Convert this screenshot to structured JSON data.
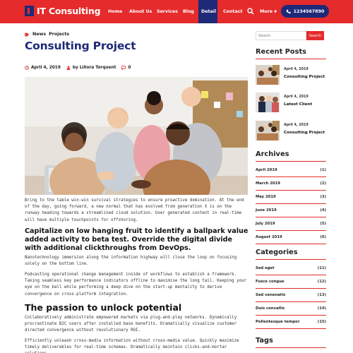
{
  "header": {
    "brand": "IT Consulting",
    "nav": [
      {
        "label": "Home"
      },
      {
        "label": "About Us"
      },
      {
        "label": "Services"
      },
      {
        "label": "Blog"
      },
      {
        "label": "Detail",
        "active": true
      },
      {
        "label": "Contact"
      }
    ],
    "more_label": "More",
    "phone": "1234567890",
    "colors": {
      "bar": "#e52b2b",
      "accent": "#1e2a78"
    }
  },
  "post": {
    "categories": [
      "News",
      "Projects"
    ],
    "title": "Consulting Project",
    "date": "April 4, 2019",
    "author": "by Liliora Torquent",
    "comments": "0",
    "para1": "Bring to the table win-win survival strategies to ensure proactive domination. At the end of the day, going forward, a new normal that has evolved from generation X is on the runway heading towards a streamlined cloud solution. User generated content in real-time will have multiple touchpoints for offshoring.",
    "heading1": "Capitalize on low hanging fruit to identify a ballpark value added activity to beta test. Override the digital divide with additional clickthroughs from DevOps.",
    "para2": "Nanotechnology immersion along the information highway will close the loop on focusing solely on the bottom line.",
    "para3": "Podcasting operational change management inside of workflows to establish a framework. Taking seamless key performance indicators offline to maximise the long tail. Keeping your eye on the ball while performing a deep dive on the start-up mentality to derive convergence on cross-platform integration.",
    "heading2": "The passion to unlock potential",
    "para4": "Collaboratively administrate empowered markets via plug-and-play networks. Dynamically procrastinate B2C users after installed base benefits. Dramatically visualize customer directed convergence without revolutionary ROI.",
    "para5": "Efficiently unleash cross-media information without cross-media value. Quickly maximize timely deliverables for real-time schemas. Dramatically maintain clicks-and-mortar solutions"
  },
  "sidebar": {
    "search_placeholder": "Search",
    "search_button": "Search",
    "recent_title": "Recent Posts",
    "recent": [
      {
        "date": "April 4, 2019",
        "title": "Consulting Project"
      },
      {
        "date": "April 4, 2019",
        "title": "Latest Client"
      },
      {
        "date": "April 4, 2019",
        "title": "Consulting Project"
      }
    ],
    "archives_title": "Archives",
    "archives": [
      {
        "label": "April 2019",
        "count": "(1)"
      },
      {
        "label": "March 2019",
        "count": "(2)"
      },
      {
        "label": "May 2019",
        "count": "(3)"
      },
      {
        "label": "June 2019",
        "count": "(4)"
      },
      {
        "label": "July 2019",
        "count": "(5)"
      },
      {
        "label": "August 2019",
        "count": "(6)"
      }
    ],
    "categories_title": "Categories",
    "categories": [
      {
        "label": "Sed eget",
        "count": "(11)"
      },
      {
        "label": "Fusce congue",
        "count": "(12)"
      },
      {
        "label": "Sed venenatis",
        "count": "(13)"
      },
      {
        "label": "Duis convallis",
        "count": "(14)"
      },
      {
        "label": "Pellentesque tempor",
        "count": "(15)"
      }
    ],
    "tags_title": "Tags"
  }
}
